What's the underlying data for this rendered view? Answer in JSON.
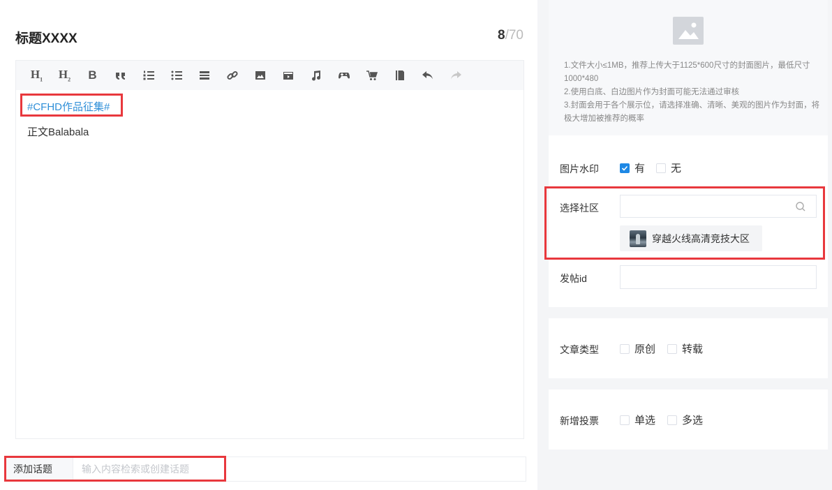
{
  "editor": {
    "title": "标题XXXX",
    "char_count": "8",
    "char_max": "/70",
    "toolbar": [
      {
        "name": "heading1-button",
        "icon": "heading-1-icon"
      },
      {
        "name": "heading2-button",
        "icon": "heading-2-icon"
      },
      {
        "name": "bold-button",
        "icon": "bold-icon"
      },
      {
        "name": "quote-button",
        "icon": "quote-icon"
      },
      {
        "name": "ordered-list-button",
        "icon": "ordered-list-icon"
      },
      {
        "name": "unordered-list-button",
        "icon": "unordered-list-icon"
      },
      {
        "name": "divider-button",
        "icon": "divider-icon"
      },
      {
        "name": "link-button",
        "icon": "link-icon"
      },
      {
        "name": "image-button",
        "icon": "image-icon"
      },
      {
        "name": "video-button",
        "icon": "video-icon"
      },
      {
        "name": "music-button",
        "icon": "music-icon"
      },
      {
        "name": "game-button",
        "icon": "gamepad-icon"
      },
      {
        "name": "shop-button",
        "icon": "cart-icon"
      },
      {
        "name": "book-button",
        "icon": "book-icon"
      },
      {
        "name": "undo-button",
        "icon": "undo-icon"
      },
      {
        "name": "redo-button",
        "icon": "redo-icon"
      }
    ],
    "hashtag": "#CFHD作品征集#",
    "body_text": "正文Balabala"
  },
  "topic": {
    "label": "添加话题",
    "placeholder": "输入内容检索或创建话题"
  },
  "cover": {
    "icon": "image-placeholder-icon",
    "notes": [
      "1.文件大小≤1MB，推荐上传大于1125*600尺寸的封面图片，最低尺寸1000*480",
      "2.使用白底、白边图片作为封面可能无法通过审核",
      "3.封面会用于各个展示位，请选择准确、清晰、美观的图片作为封面，将极大增加被推荐的概率"
    ]
  },
  "settings": {
    "watermark": {
      "label": "图片水印",
      "options": [
        {
          "label": "有",
          "checked": true
        },
        {
          "label": "无",
          "checked": false
        }
      ]
    },
    "community": {
      "label": "选择社区",
      "search_value": "",
      "selected": "穿越火线高清竞技大区"
    },
    "post_id": {
      "label": "发帖id",
      "value": ""
    },
    "article_type": {
      "label": "文章类型",
      "options": [
        {
          "label": "原创",
          "checked": false
        },
        {
          "label": "转载",
          "checked": false
        }
      ]
    },
    "vote": {
      "label": "新增投票",
      "options": [
        {
          "label": "单选",
          "checked": false
        },
        {
          "label": "多选",
          "checked": false
        }
      ]
    }
  },
  "colors": {
    "accent": "#1e88e5",
    "hashtag": "#2f8fd8",
    "highlight": "#e8383d"
  }
}
